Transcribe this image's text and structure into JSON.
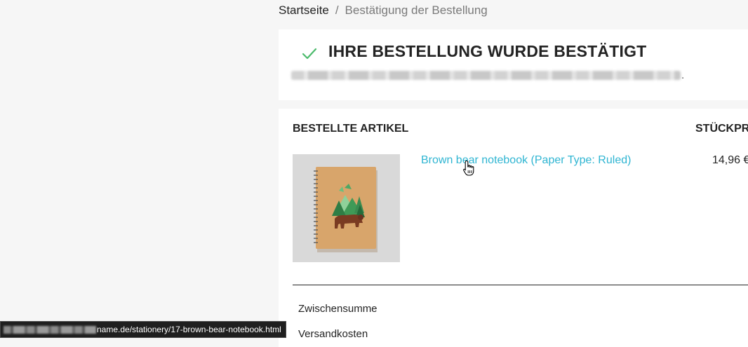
{
  "breadcrumb": {
    "home": "Startseite",
    "separator": "/",
    "current": "Bestätigung der Bestellung"
  },
  "confirmation": {
    "title": "IHRE BESTELLUNG WURDE BESTÄTIGT",
    "check_icon": "check-icon",
    "accent_color": "#4cbb6c",
    "blurred_trailing_dot": "."
  },
  "order_items": {
    "heading": "BESTELLTE ARTIKEL",
    "unit_price_heading": "STÜCKPR",
    "items": [
      {
        "name": "Brown bear notebook (Paper Type: Ruled)",
        "unit_price": "14,96 €",
        "image_icon": "brown-bear-notebook-image"
      }
    ],
    "link_color": "#2fb5d2"
  },
  "totals": {
    "subtotal_label": "Zwischensumme",
    "shipping_label": "Versandkosten"
  },
  "status_bar": {
    "url_visible": "name.de/stationery/17-brown-bear-notebook.html"
  }
}
